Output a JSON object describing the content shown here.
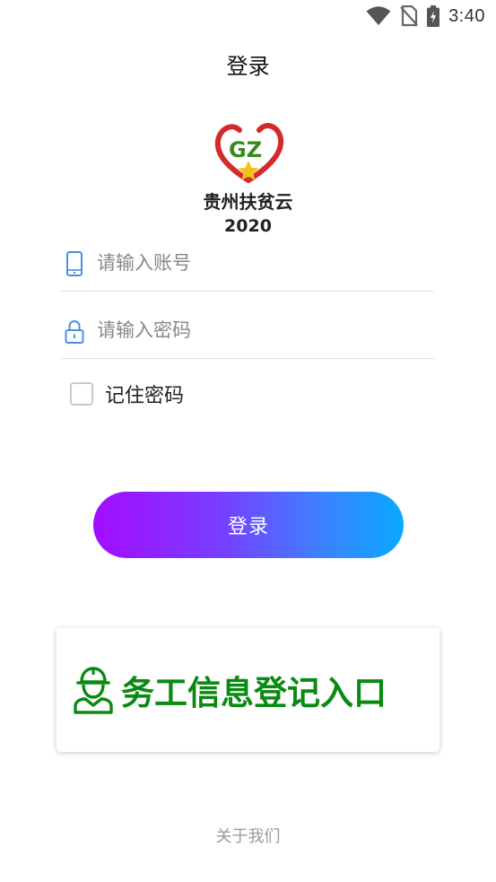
{
  "status_bar": {
    "time": "3:40",
    "icons": [
      "wifi-icon",
      "no-sim-icon",
      "battery-charging-icon"
    ]
  },
  "header": {
    "title": "登录"
  },
  "logo": {
    "mark_text": "GZ",
    "app_name": "贵州扶贫云",
    "year": "2020",
    "colors": {
      "heart": "#d42a2a",
      "letters": "#3a8a1e",
      "star": "#f2c21b"
    }
  },
  "form": {
    "account": {
      "placeholder": "请输入账号",
      "value": "",
      "icon": "phone-icon"
    },
    "password": {
      "placeholder": "请输入密码",
      "value": "",
      "icon": "lock-icon"
    },
    "remember": {
      "label": "记住密码",
      "checked": false
    }
  },
  "login_button": {
    "label": "登录",
    "gradient": [
      "#a30cff",
      "#0aa8ff"
    ]
  },
  "worker_entry": {
    "label": "务工信息登记入口",
    "icon": "worker-icon",
    "color": "#0a8a12"
  },
  "footer": {
    "about_label": "关于我们"
  }
}
